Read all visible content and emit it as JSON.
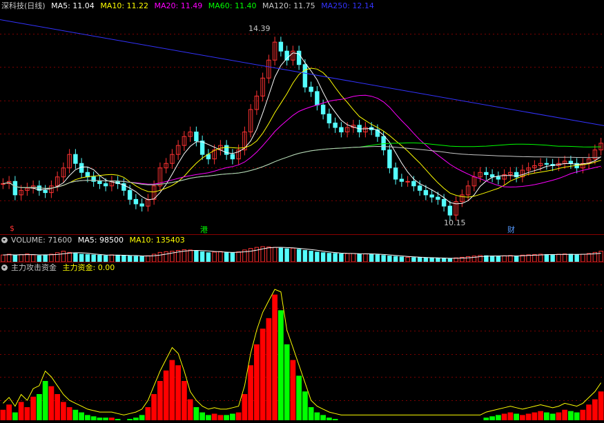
{
  "main": {
    "stock_name": "深科技(日线)",
    "ma": [
      {
        "label": "MA5: 11.04",
        "color": "#ffffff"
      },
      {
        "label": "MA10: 11.22",
        "color": "#ffff00"
      },
      {
        "label": "MA20: 11.49",
        "color": "#ff00ff"
      },
      {
        "label": "MA60: 11.40",
        "color": "#00ff00"
      },
      {
        "label": "MA120: 11.75",
        "color": "#c8c8c8"
      },
      {
        "label": "MA250: 12.14",
        "color": "#3333ff"
      }
    ],
    "high_label": "14.39",
    "low_label": "10.15",
    "markers": [
      {
        "text": "$",
        "color": "#ff3333"
      },
      {
        "text": "港",
        "color": "#00ff00"
      },
      {
        "text": "财",
        "color": "#5599ff"
      }
    ]
  },
  "volume": {
    "label": "VOLUME: 71600",
    "ma5": "MA5: 98500",
    "ma10": "MA10: 135403"
  },
  "indicator": {
    "name": "主力攻击资金",
    "series_label": "主力资金: 0.00"
  },
  "colors": {
    "up": "#ff3232",
    "down": "#54ffff",
    "grid": "#800000",
    "bg": "#000000"
  },
  "chart_data": {
    "type": "candlestick",
    "price_range": [
      10.0,
      14.6
    ],
    "close": [
      10.85,
      10.9,
      10.6,
      10.7,
      10.75,
      10.8,
      10.7,
      10.65,
      10.8,
      11.0,
      11.2,
      11.5,
      11.3,
      11.1,
      11.0,
      10.9,
      10.85,
      10.8,
      10.9,
      10.85,
      10.7,
      10.5,
      10.4,
      10.35,
      10.5,
      10.8,
      11.2,
      11.3,
      11.5,
      11.7,
      11.9,
      12.0,
      11.8,
      11.5,
      11.4,
      11.6,
      11.7,
      11.5,
      11.4,
      11.6,
      12.0,
      12.5,
      12.8,
      13.2,
      13.6,
      14.0,
      13.8,
      13.6,
      13.8,
      13.5,
      13.0,
      12.9,
      12.6,
      12.4,
      12.2,
      12.1,
      12.0,
      12.1,
      12.15,
      12.0,
      12.1,
      12.05,
      11.9,
      11.6,
      11.2,
      10.95,
      10.9,
      10.9,
      10.8,
      10.7,
      10.6,
      10.55,
      10.5,
      10.35,
      10.15,
      10.45,
      10.6,
      10.8,
      11.0,
      11.1,
      11.05,
      11.0,
      10.95,
      11.05,
      11.1,
      11.0,
      11.15,
      11.2,
      11.25,
      11.3,
      11.28,
      11.25,
      11.3,
      11.35,
      11.3,
      11.2,
      11.3,
      11.4,
      11.6,
      11.75
    ],
    "volume": [
      0.45,
      0.5,
      0.42,
      0.48,
      0.52,
      0.46,
      0.4,
      0.44,
      0.5,
      0.6,
      0.7,
      0.62,
      0.55,
      0.5,
      0.48,
      0.45,
      0.43,
      0.4,
      0.46,
      0.44,
      0.42,
      0.38,
      0.36,
      0.35,
      0.4,
      0.5,
      0.62,
      0.66,
      0.7,
      0.75,
      0.8,
      0.78,
      0.72,
      0.66,
      0.6,
      0.64,
      0.68,
      0.6,
      0.58,
      0.66,
      0.78,
      0.88,
      0.95,
      1.0,
      0.98,
      0.95,
      0.9,
      0.86,
      0.9,
      0.82,
      0.75,
      0.7,
      0.64,
      0.6,
      0.56,
      0.55,
      0.52,
      0.54,
      0.55,
      0.5,
      0.52,
      0.5,
      0.46,
      0.42,
      0.38,
      0.35,
      0.32,
      0.3,
      0.28,
      0.27,
      0.26,
      0.25,
      0.24,
      0.22,
      0.2,
      0.26,
      0.3,
      0.34,
      0.38,
      0.42,
      0.4,
      0.38,
      0.36,
      0.4,
      0.42,
      0.38,
      0.44,
      0.46,
      0.48,
      0.5,
      0.48,
      0.46,
      0.5,
      0.52,
      0.5,
      0.46,
      0.5,
      0.55,
      0.62,
      0.7
    ],
    "fund": [
      0.08,
      0.12,
      0.06,
      0.14,
      0.1,
      0.18,
      0.2,
      0.3,
      0.26,
      0.2,
      0.14,
      0.1,
      0.08,
      0.06,
      0.04,
      0.03,
      0.02,
      0.02,
      0.02,
      0.01,
      0.0,
      0.01,
      0.02,
      0.04,
      0.1,
      0.2,
      0.3,
      0.38,
      0.46,
      0.42,
      0.3,
      0.16,
      0.1,
      0.06,
      0.04,
      0.05,
      0.04,
      0.04,
      0.05,
      0.06,
      0.2,
      0.42,
      0.58,
      0.7,
      0.78,
      0.96,
      0.84,
      0.58,
      0.46,
      0.34,
      0.22,
      0.1,
      0.06,
      0.04,
      0.02,
      0.01,
      0.0,
      0.0,
      0.0,
      0.0,
      0.0,
      0.0,
      0.0,
      0.0,
      0.0,
      0.0,
      0.0,
      0.0,
      0.0,
      0.0,
      0.0,
      0.0,
      0.0,
      0.0,
      0.0,
      0.0,
      0.0,
      0.0,
      0.0,
      0.0,
      0.02,
      0.03,
      0.04,
      0.05,
      0.06,
      0.05,
      0.04,
      0.05,
      0.06,
      0.07,
      0.06,
      0.05,
      0.06,
      0.08,
      0.07,
      0.06,
      0.08,
      0.12,
      0.16,
      0.22
    ]
  }
}
